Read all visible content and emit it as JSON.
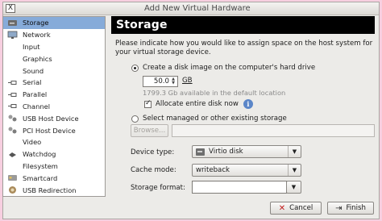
{
  "window": {
    "title": "Add New Virtual Hardware"
  },
  "sidebar": {
    "items": [
      {
        "label": "Storage",
        "icon": "storage-icon",
        "active": true
      },
      {
        "label": "Network",
        "icon": "network-icon"
      },
      {
        "label": "Input",
        "icon": "input-icon"
      },
      {
        "label": "Graphics",
        "icon": "graphics-icon"
      },
      {
        "label": "Sound",
        "icon": "sound-icon"
      },
      {
        "label": "Serial",
        "icon": "serial-icon"
      },
      {
        "label": "Parallel",
        "icon": "parallel-icon"
      },
      {
        "label": "Channel",
        "icon": "channel-icon"
      },
      {
        "label": "USB Host Device",
        "icon": "usb-host-icon"
      },
      {
        "label": "PCI Host Device",
        "icon": "pci-host-icon"
      },
      {
        "label": "Video",
        "icon": "video-icon"
      },
      {
        "label": "Watchdog",
        "icon": "watchdog-icon"
      },
      {
        "label": "Filesystem",
        "icon": "filesystem-icon"
      },
      {
        "label": "Smartcard",
        "icon": "smartcard-icon"
      },
      {
        "label": "USB Redirection",
        "icon": "usb-redirection-icon"
      }
    ]
  },
  "main": {
    "heading": "Storage",
    "description": "Please indicate how you would like to assign space on the host system for your virtual storage device.",
    "create_option": {
      "label": "Create a disk image on the computer's hard drive",
      "selected": true
    },
    "size": {
      "value": "50.0",
      "unit": "GB"
    },
    "available_text": "1799.3 Gb available in the default location",
    "allocate": {
      "label": "Allocate entire disk now",
      "checked": true
    },
    "select_option": {
      "label": "Select managed or other existing storage",
      "selected": false
    },
    "browse_label": "Browse...",
    "path_value": "",
    "device_type": {
      "label": "Device type:",
      "value": "Virtio disk"
    },
    "cache_mode": {
      "label": "Cache mode:",
      "value": "writeback"
    },
    "storage_format": {
      "label": "Storage format:",
      "value": ""
    }
  },
  "footer": {
    "cancel_label": "Cancel",
    "finish_label": "Finish"
  },
  "colors": {
    "selection": "#86abd9",
    "header_bg": "#000000",
    "info": "#5b86c8",
    "cancel_icon": "#c21c1c"
  }
}
